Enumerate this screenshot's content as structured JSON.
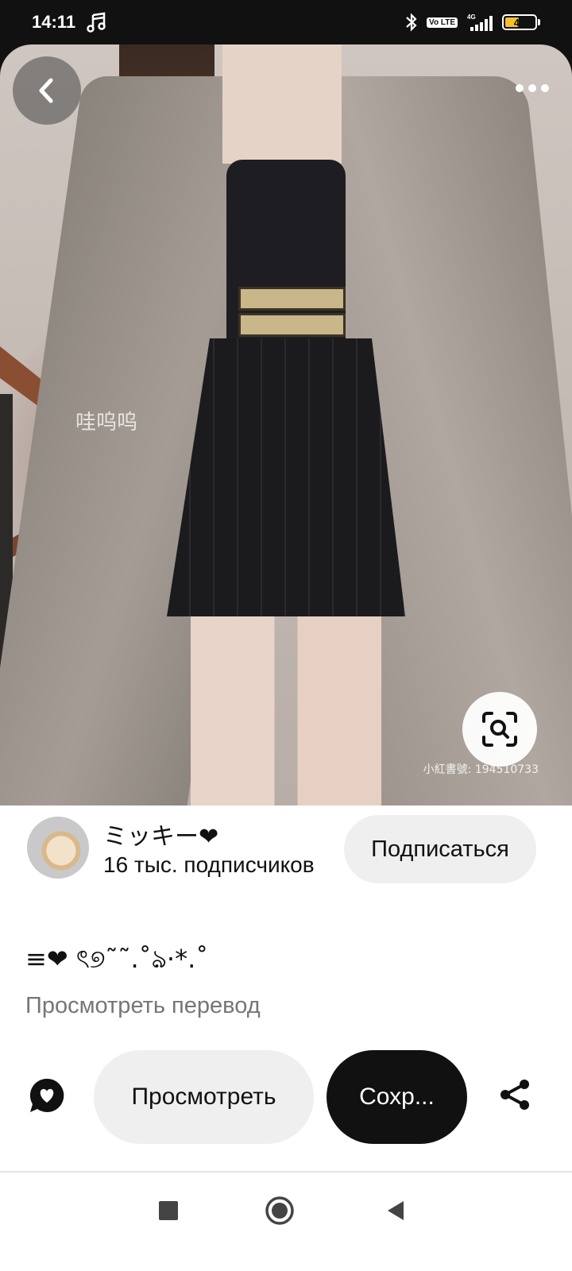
{
  "status_bar": {
    "time": "14:11",
    "battery": "46",
    "battery_level": 0.46,
    "network": "4G",
    "volte": "Vo LTE",
    "icons": [
      "music-note-icon",
      "bluetooth-icon",
      "volte-icon",
      "signal-icon",
      "battery-icon"
    ]
  },
  "pin": {
    "watermark_cn": "哇呜呜",
    "watermark_id": "小紅書號: 194510733",
    "actions": {
      "back_icon": "back-arrow-icon",
      "more_icon": "more-dots-icon",
      "lens_icon": "visual-search-icon"
    }
  },
  "creator": {
    "name": "ミッキー❤",
    "followers": "16 тыс. подписчиков",
    "subscribe_label": "Подписаться"
  },
  "description": "≡❤ ৎ୭˜˜.˚ঌ·*.˚",
  "translate_label": "Просмотреть перевод",
  "actions": {
    "view_label": "Просмотреть",
    "save_label": "Сохр...",
    "comment_icon": "comment-heart-icon",
    "share_icon": "share-icon"
  },
  "nav": {
    "icons": [
      "recent-apps-icon",
      "home-icon",
      "back-triangle-icon"
    ]
  },
  "colors": {
    "save_button": "#111111",
    "pill_background": "#efefef",
    "secondary_text": "#767676",
    "battery": "#f5c02a"
  }
}
